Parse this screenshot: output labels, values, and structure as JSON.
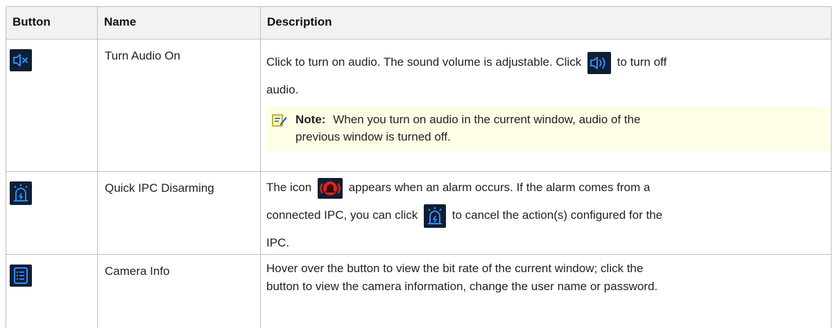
{
  "header": {
    "col_button": "Button",
    "col_name": "Name",
    "col_description": "Description"
  },
  "rows": [
    {
      "icon": "speaker-muted-icon",
      "name": "Turn Audio On",
      "desc_part1": "Click to turn on audio. The sound volume is adjustable. Click",
      "desc_part2": "to turn off",
      "desc_part3": "audio.",
      "inline_icon": "speaker-on-icon",
      "note_label": "Note:",
      "note_text_line1": "When you turn on audio in the current window, audio of the",
      "note_text_line2": "previous window is turned off."
    },
    {
      "icon": "alarm-disarm-icon",
      "name": "Quick IPC Disarming",
      "desc_part1": "The icon",
      "desc_part2": "appears when an alarm occurs. If the alarm comes from a",
      "desc_part3": "connected IPC, you can click",
      "desc_part4": "to cancel the action(s) configured for the",
      "desc_part5": "IPC.",
      "inline_icon_1": "red-alarm-bell-icon",
      "inline_icon_2": "alarm-disarm-icon"
    },
    {
      "icon": "camera-info-list-icon",
      "name": "Camera Info",
      "desc_line1": "Hover over the button to view the bit rate of the current window; click the",
      "desc_line2": "button to view the camera information, change the user name or password."
    }
  ],
  "colors": {
    "icon_bg": "#0f1f33",
    "icon_blue": "#2f8fff",
    "alarm_red": "#e0241b",
    "note_bg": "#fffde6",
    "note_icon": "#b09a1c",
    "header_bg": "#f2f2f2",
    "border": "#bdbdbd"
  }
}
